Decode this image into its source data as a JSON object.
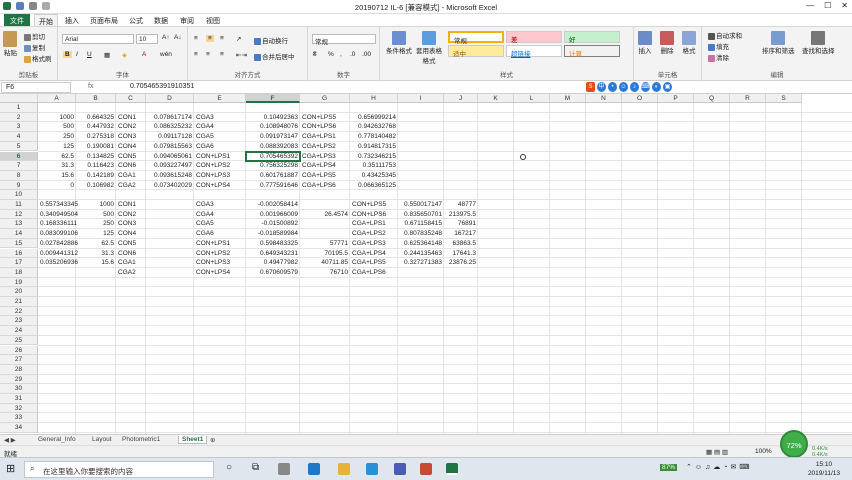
{
  "titlebar": {
    "title": "20190712 IL-6  [兼容模式]  -  Microsoft Excel",
    "controls": [
      "—",
      "☐",
      "✕"
    ]
  },
  "tabs": [
    "文件",
    "开始",
    "插入",
    "页面布局",
    "公式",
    "数据",
    "审阅",
    "视图"
  ],
  "ribbon": {
    "clipboard": {
      "paste": "粘贴",
      "cut": "剪切",
      "copy": "复制",
      "format_painter": "格式刷",
      "label": "剪贴板"
    },
    "font": {
      "name": "Arial",
      "size": "10",
      "label": "字体",
      "bold": "B",
      "italic": "I",
      "underline": "U"
    },
    "alignment": {
      "wrap": "自动换行",
      "merge": "合并后居中",
      "label": "对齐方式"
    },
    "number": {
      "format": "常规",
      "label": "数字",
      "percent": "%",
      "comma": ","
    },
    "styles": {
      "cond": "条件格式",
      "table": "套用表格格式",
      "normal": "常规",
      "bad": "差",
      "good": "好",
      "neutral": "适中",
      "hyperlink": "超链接",
      "calc": "计算",
      "label": "样式"
    },
    "cells": {
      "insert": "插入",
      "delete": "删除",
      "format": "格式",
      "label": "单元格"
    },
    "editing": {
      "autosum": "自动求和",
      "fill": "填充",
      "clear": "清除",
      "sort": "排序和筛选",
      "find": "查找和选择",
      "label": "编辑"
    }
  },
  "formula_bar": {
    "name_box": "F6",
    "fx": "fx",
    "value": "0.705465391910351"
  },
  "columns": [
    "A",
    "B",
    "C",
    "D",
    "E",
    "F",
    "G",
    "H",
    "I",
    "J",
    "K",
    "L",
    "M",
    "N",
    "O",
    "P",
    "Q",
    "R",
    "S"
  ],
  "rows": [
    "1",
    "2",
    "3",
    "4",
    "5",
    "6",
    "7",
    "8",
    "9",
    "10",
    "11",
    "12",
    "13",
    "14",
    "15",
    "16",
    "17",
    "18",
    "19",
    "20",
    "21",
    "22",
    "23",
    "24",
    "25",
    "26",
    "27",
    "28",
    "29",
    "30",
    "31",
    "32",
    "33",
    "34"
  ],
  "cells": {
    "A2": "1000",
    "B2": "0.664325",
    "C2": "CON1",
    "D2": "0.078617174",
    "E2": "CGA3",
    "F2": "0.10492363",
    "G2": "CON+LPS5",
    "H2": "0.656999214",
    "A3": "500",
    "B3": "0.447932",
    "C3": "CON2",
    "D3": "0.086325232",
    "E3": "CGA4",
    "F3": "0.108948076",
    "G3": "CON+LPS6",
    "H3": "0.942632768",
    "A4": "250",
    "B4": "0.275318",
    "C4": "CON3",
    "D4": "0.09117128",
    "E4": "CGA5",
    "F4": "0.091973147",
    "G4": "CGA+LPS1",
    "H4": "0.778140482",
    "A5": "125",
    "B5": "0.190081",
    "C5": "CON4",
    "D5": "0.079815563",
    "E5": "CGA6",
    "F5": "0.088392083",
    "G5": "CGA+LPS2",
    "H5": "0.914817315",
    "A6": "62.5",
    "B6": "0.134825",
    "C6": "CON5",
    "D6": "0.094065061",
    "E6": "CON+LPS1",
    "F6": "0.705465392",
    "G6": "CGA+LPS3",
    "H6": "0.732346215",
    "A7": "31.3",
    "B7": "0.116423",
    "C7": "CON6",
    "D7": "0.093227497",
    "E7": "CON+LPS2",
    "F7": "0.756325298",
    "G7": "CGA+LPS4",
    "H7": "0.35111753",
    "A8": "15.6",
    "B8": "0.142189",
    "C8": "CGA1",
    "D8": "0.093615248",
    "E8": "CON+LPS3",
    "F8": "0.601761887",
    "G8": "CGA+LPS5",
    "H8": "0.43425345",
    "A9": "0",
    "B9": "0.106982",
    "C9": "CGA2",
    "D9": "0.073402029",
    "E9": "CON+LPS4",
    "F9": "0.777591646",
    "G9": "CGA+LPS6",
    "H9": "0.066365125",
    "A11": "0.557343345",
    "B11": "1000",
    "C11": "CON1",
    "E11": "CGA3",
    "F11": "-0.002058414",
    "H11": "CON+LPS5",
    "I11": "0.550017147",
    "J11": "48777",
    "A12": "0.340949504",
    "B12": "500",
    "C12": "CON2",
    "E12": "CGA4",
    "F12": "0.001966009",
    "G12": "26.4574",
    "H12": "CON+LPS6",
    "I12": "0.835650701",
    "J12": "213975.5",
    "A13": "0.168336111",
    "B13": "250",
    "C13": "CON3",
    "E13": "CGA5",
    "F13": "-0.01500892",
    "H13": "CGA+LPS1",
    "I13": "0.671158415",
    "J13": "76891",
    "A14": "0.083099106",
    "B14": "125",
    "C14": "CON4",
    "E14": "CGA6",
    "F14": "-0.018589984",
    "H14": "CGA+LPS2",
    "I14": "0.807835248",
    "J14": "167217",
    "A15": "0.027842886",
    "B15": "62.5",
    "C15": "CON5",
    "E15": "CON+LPS1",
    "F15": "0.598483325",
    "G15": "57771",
    "H15": "CGA+LPS3",
    "I15": "0.625364148",
    "J15": "63863.5",
    "A16": "0.009441312",
    "B16": "31.3",
    "C16": "CON6",
    "E16": "CON+LPS2",
    "F16": "0.649343231",
    "G16": "70195.5",
    "H16": "CGA+LPS4",
    "I16": "0.244135463",
    "J16": "17641.3",
    "A17": "0.035206936",
    "B17": "15.6",
    "C17": "CGA1",
    "E17": "CON+LPS3",
    "F17": "0.49477982",
    "G17": "40711.85",
    "H17": "CGA+LPS5",
    "I17": "0.327271383",
    "J17": "23876.25",
    "C18": "CGA2",
    "E18": "CON+LPS4",
    "F18": "0.670609579",
    "G18": "76710",
    "H18": "CGA+LPS6"
  },
  "sheets": [
    "General_Info",
    "Layout",
    "Photometric1",
    "Sheet1"
  ],
  "active_sheet": "Sheet1",
  "status": {
    "ready": "就绪",
    "zoom": "100%",
    "perf": "72%",
    "net_up": "0.4K/s",
    "net_down": "0.4K/s"
  },
  "taskbar": {
    "search_placeholder": "在这里输入你要搜索的内容",
    "time": "15:10",
    "date": "2019/11/13",
    "battery": "87%"
  },
  "colors": {
    "excel_green": "#217346",
    "header_bg": "#f0f0f0"
  }
}
